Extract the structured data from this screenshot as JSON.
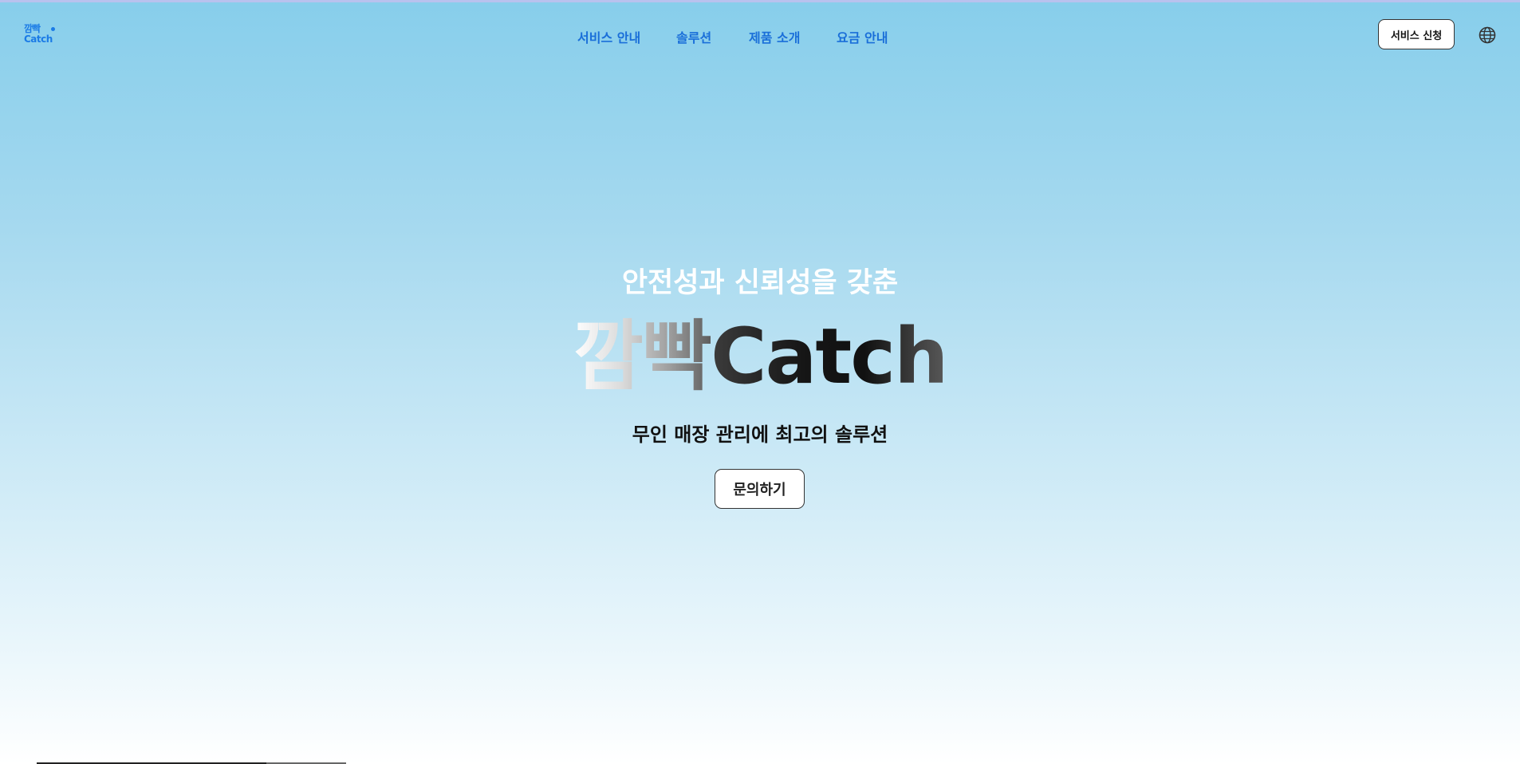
{
  "header": {
    "logo": {
      "line1": "깜빡",
      "line2": "Catch"
    },
    "nav": [
      {
        "label": "서비스 안내"
      },
      {
        "label": "솔루션"
      },
      {
        "label": "제품 소개"
      },
      {
        "label": "요금 안내"
      }
    ],
    "apply_label": "서비스 신청",
    "language_icon": "globe-icon"
  },
  "hero": {
    "subtitle": "안전성과 신뢰성을 갖춘",
    "title_korean": "깜빡",
    "title_english": "Catch",
    "description": "무인 매장 관리에 최고의 솔루션",
    "inquiry_label": "문의하기"
  },
  "colors": {
    "accent": "#1a6fd9",
    "bg_top": "#87ceeb",
    "bg_bottom": "#ffffff"
  }
}
